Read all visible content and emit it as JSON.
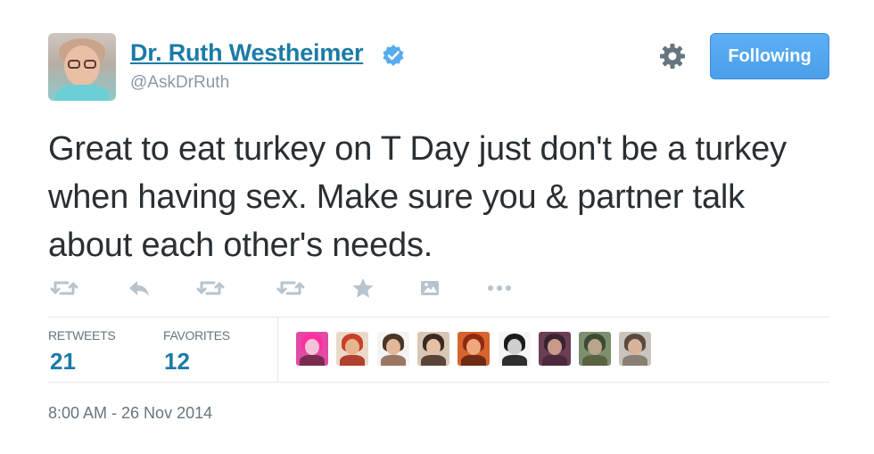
{
  "tweet": {
    "author": {
      "name": "Dr. Ruth Westheimer",
      "handle": "@AskDrRuth",
      "verified": true
    },
    "follow_button": "Following",
    "text": "Great to eat turkey on T Day just don't be a turkey when having sex. Make sure you & partner talk about each other's needs.",
    "stats": {
      "retweets_label": "RETWEETS",
      "retweets_count": "21",
      "favorites_label": "FAVORITES",
      "favorites_count": "12"
    },
    "timestamp": "8:00 AM - 26 Nov 2014"
  },
  "icons": {
    "actions": [
      "retweet-icon",
      "reply-icon",
      "retweet-icon",
      "retweet-icon",
      "favorite-star-icon",
      "image-icon",
      "more-icon"
    ],
    "settings": "gear-icon",
    "verified": "verified-badge-icon"
  },
  "colors": {
    "link": "#1b7ba5",
    "button": "#4a9fe8",
    "muted": "#8899a6",
    "icon": "#b7c4cd"
  }
}
